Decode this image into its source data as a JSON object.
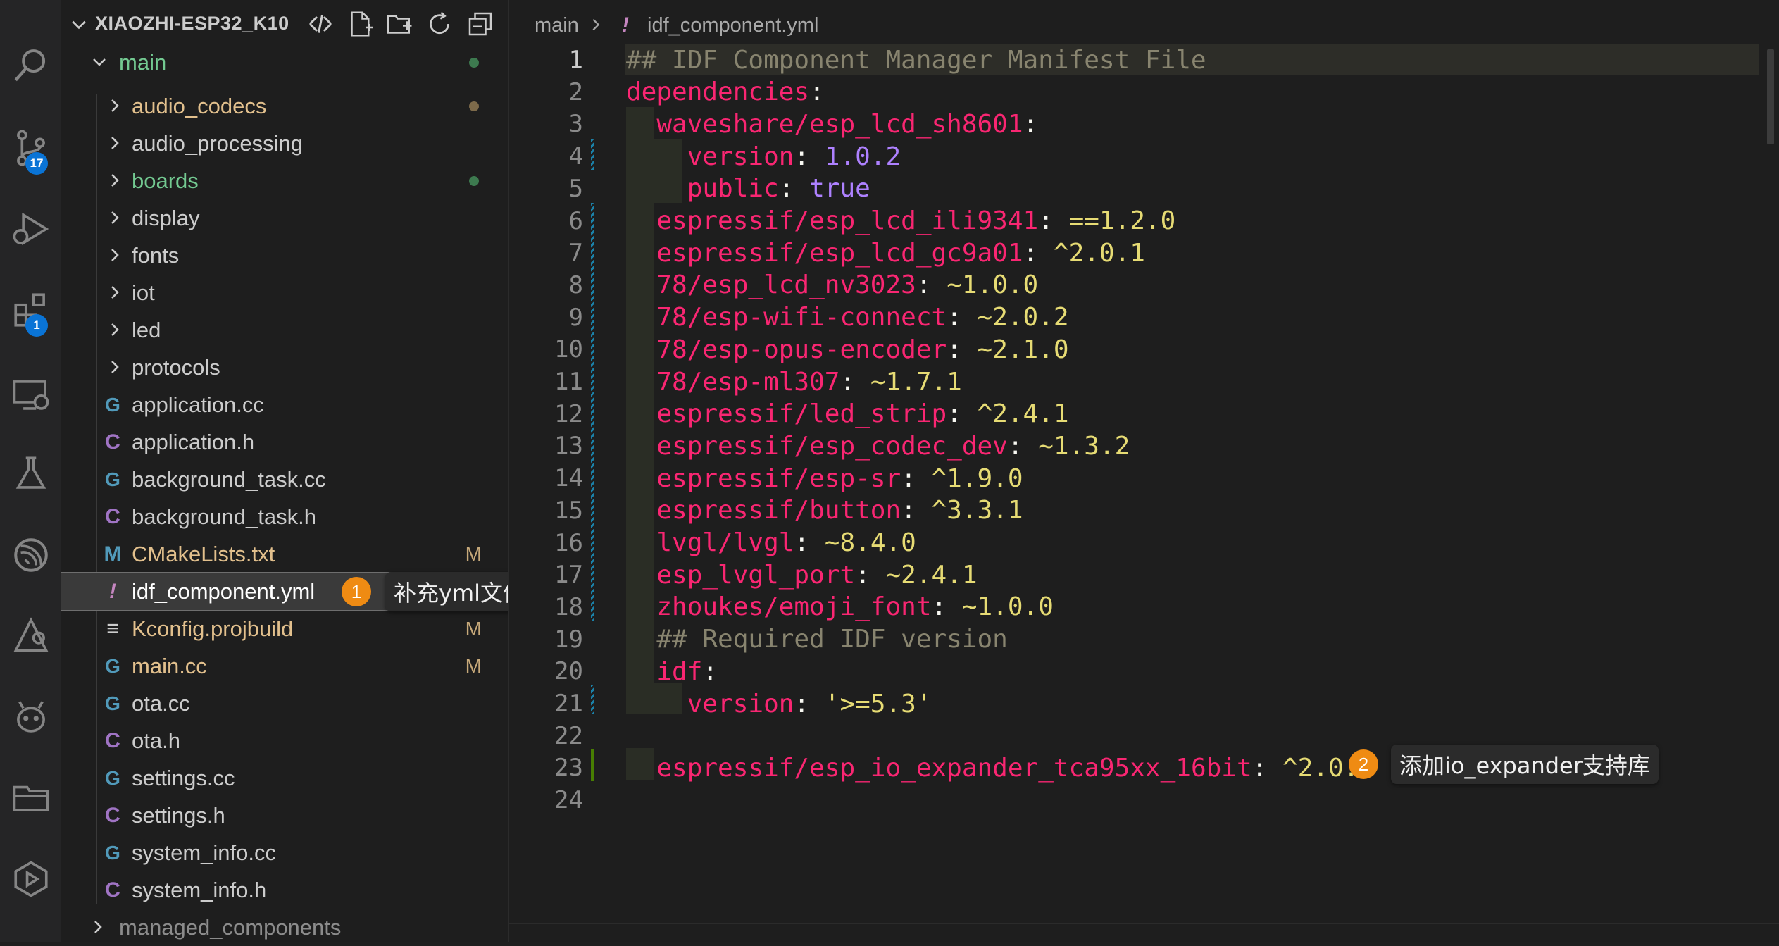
{
  "explorer": {
    "project_title": "XIAOZHI-ESP32_K10",
    "items": [
      {
        "label": "main",
        "kind": "folder-open",
        "color": "#73c991",
        "status": "dot-green"
      },
      {
        "label": "audio_codecs",
        "kind": "folder",
        "color": "#e2c08d",
        "status": "dot-brown"
      },
      {
        "label": "audio_processing",
        "kind": "folder",
        "color": "#cccccc",
        "status": ""
      },
      {
        "label": "boards",
        "kind": "folder",
        "color": "#73c991",
        "status": "dot-green"
      },
      {
        "label": "display",
        "kind": "folder",
        "color": "#cccccc",
        "status": ""
      },
      {
        "label": "fonts",
        "kind": "folder",
        "color": "#cccccc",
        "status": ""
      },
      {
        "label": "iot",
        "kind": "folder",
        "color": "#cccccc",
        "status": ""
      },
      {
        "label": "led",
        "kind": "folder",
        "color": "#cccccc",
        "status": ""
      },
      {
        "label": "protocols",
        "kind": "folder",
        "color": "#cccccc",
        "status": ""
      },
      {
        "label": "application.cc",
        "kind": "cpp",
        "color": "#cccccc",
        "status": ""
      },
      {
        "label": "application.h",
        "kind": "c",
        "color": "#cccccc",
        "status": ""
      },
      {
        "label": "background_task.cc",
        "kind": "cpp",
        "color": "#cccccc",
        "status": ""
      },
      {
        "label": "background_task.h",
        "kind": "c",
        "color": "#cccccc",
        "status": ""
      },
      {
        "label": "CMakeLists.txt",
        "kind": "cmake",
        "color": "#e2c08d",
        "status": "M"
      },
      {
        "label": "idf_component.yml",
        "kind": "yml",
        "color": "#ffffff",
        "status": ""
      },
      {
        "label": "Kconfig.projbuild",
        "kind": "text",
        "color": "#e2c08d",
        "status": "M"
      },
      {
        "label": "main.cc",
        "kind": "cpp",
        "color": "#e2c08d",
        "status": "M"
      },
      {
        "label": "ota.cc",
        "kind": "cpp",
        "color": "#cccccc",
        "status": ""
      },
      {
        "label": "ota.h",
        "kind": "c",
        "color": "#cccccc",
        "status": ""
      },
      {
        "label": "settings.cc",
        "kind": "cpp",
        "color": "#cccccc",
        "status": ""
      },
      {
        "label": "settings.h",
        "kind": "c",
        "color": "#cccccc",
        "status": ""
      },
      {
        "label": "system_info.cc",
        "kind": "cpp",
        "color": "#cccccc",
        "status": ""
      },
      {
        "label": "system_info.h",
        "kind": "c",
        "color": "#cccccc",
        "status": ""
      },
      {
        "label": "managed_components",
        "kind": "folder-root",
        "color": "#8c8c8c",
        "status": ""
      }
    ]
  },
  "activity": {
    "scm_badge": "17",
    "extensions_badge": "1"
  },
  "callouts": {
    "one": {
      "num": "1",
      "text": "补充yml文件"
    },
    "two": {
      "num": "2",
      "text": "添加io_expander支持库"
    }
  },
  "breadcrumb": {
    "folder": "main",
    "file_icon": "!",
    "file": "idf_component.yml"
  },
  "code": {
    "lines": [
      {
        "n": "1",
        "tokens": [
          [
            "c",
            "## IDF Component Manager Manifest File"
          ]
        ]
      },
      {
        "n": "2",
        "tokens": [
          [
            "k",
            "dependencies"
          ],
          [
            "p",
            ":"
          ]
        ]
      },
      {
        "n": "3",
        "tokens": [
          [
            "p",
            "  "
          ],
          [
            "k",
            "waveshare/esp_lcd_sh8601"
          ],
          [
            "p",
            ":"
          ]
        ]
      },
      {
        "n": "4",
        "tokens": [
          [
            "p",
            "    "
          ],
          [
            "k",
            "version"
          ],
          [
            "p",
            ": "
          ],
          [
            "n",
            "1.0.2"
          ]
        ]
      },
      {
        "n": "5",
        "tokens": [
          [
            "p",
            "    "
          ],
          [
            "k",
            "public"
          ],
          [
            "p",
            ": "
          ],
          [
            "n",
            "true"
          ]
        ]
      },
      {
        "n": "6",
        "tokens": [
          [
            "p",
            "  "
          ],
          [
            "k",
            "espressif/esp_lcd_ili9341"
          ],
          [
            "p",
            ": "
          ],
          [
            "v",
            "==1.2.0"
          ]
        ]
      },
      {
        "n": "7",
        "tokens": [
          [
            "p",
            "  "
          ],
          [
            "k",
            "espressif/esp_lcd_gc9a01"
          ],
          [
            "p",
            ": "
          ],
          [
            "v",
            "^2.0.1"
          ]
        ]
      },
      {
        "n": "8",
        "tokens": [
          [
            "p",
            "  "
          ],
          [
            "k",
            "78/esp_lcd_nv3023"
          ],
          [
            "p",
            ": "
          ],
          [
            "v",
            "~1.0.0"
          ]
        ]
      },
      {
        "n": "9",
        "tokens": [
          [
            "p",
            "  "
          ],
          [
            "k",
            "78/esp-wifi-connect"
          ],
          [
            "p",
            ": "
          ],
          [
            "v",
            "~2.0.2"
          ]
        ]
      },
      {
        "n": "10",
        "tokens": [
          [
            "p",
            "  "
          ],
          [
            "k",
            "78/esp-opus-encoder"
          ],
          [
            "p",
            ": "
          ],
          [
            "v",
            "~2.1.0"
          ]
        ]
      },
      {
        "n": "11",
        "tokens": [
          [
            "p",
            "  "
          ],
          [
            "k",
            "78/esp-ml307"
          ],
          [
            "p",
            ": "
          ],
          [
            "v",
            "~1.7.1"
          ]
        ]
      },
      {
        "n": "12",
        "tokens": [
          [
            "p",
            "  "
          ],
          [
            "k",
            "espressif/led_strip"
          ],
          [
            "p",
            ": "
          ],
          [
            "v",
            "^2.4.1"
          ]
        ]
      },
      {
        "n": "13",
        "tokens": [
          [
            "p",
            "  "
          ],
          [
            "k",
            "espressif/esp_codec_dev"
          ],
          [
            "p",
            ": "
          ],
          [
            "v",
            "~1.3.2"
          ]
        ]
      },
      {
        "n": "14",
        "tokens": [
          [
            "p",
            "  "
          ],
          [
            "k",
            "espressif/esp-sr"
          ],
          [
            "p",
            ": "
          ],
          [
            "v",
            "^1.9.0"
          ]
        ]
      },
      {
        "n": "15",
        "tokens": [
          [
            "p",
            "  "
          ],
          [
            "k",
            "espressif/button"
          ],
          [
            "p",
            ": "
          ],
          [
            "v",
            "^3.3.1"
          ]
        ]
      },
      {
        "n": "16",
        "tokens": [
          [
            "p",
            "  "
          ],
          [
            "k",
            "lvgl/lvgl"
          ],
          [
            "p",
            ": "
          ],
          [
            "v",
            "~8.4.0"
          ]
        ]
      },
      {
        "n": "17",
        "tokens": [
          [
            "p",
            "  "
          ],
          [
            "k",
            "esp_lvgl_port"
          ],
          [
            "p",
            ": "
          ],
          [
            "v",
            "~2.4.1"
          ]
        ]
      },
      {
        "n": "18",
        "tokens": [
          [
            "p",
            "  "
          ],
          [
            "k",
            "zhoukes/emoji_font"
          ],
          [
            "p",
            ": "
          ],
          [
            "v",
            "~1.0.0"
          ]
        ]
      },
      {
        "n": "19",
        "tokens": [
          [
            "p",
            "  "
          ],
          [
            "c",
            "## Required IDF version"
          ]
        ]
      },
      {
        "n": "20",
        "tokens": [
          [
            "p",
            "  "
          ],
          [
            "k",
            "idf"
          ],
          [
            "p",
            ":"
          ]
        ]
      },
      {
        "n": "21",
        "tokens": [
          [
            "p",
            "    "
          ],
          [
            "k",
            "version"
          ],
          [
            "p",
            ": "
          ],
          [
            "v",
            "'>=5.3'"
          ]
        ]
      },
      {
        "n": "22",
        "tokens": []
      },
      {
        "n": "23",
        "tokens": [
          [
            "p",
            "  "
          ],
          [
            "k",
            "espressif/esp_io_expander_tca95xx_16bit"
          ],
          [
            "p",
            ": "
          ],
          [
            "v",
            "^2.0.0"
          ]
        ]
      },
      {
        "n": "24",
        "tokens": []
      }
    ]
  }
}
